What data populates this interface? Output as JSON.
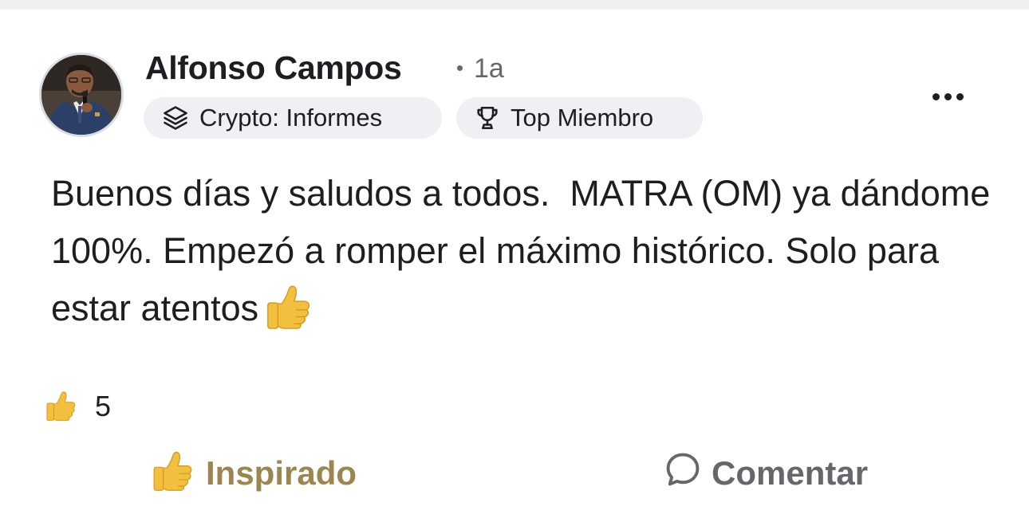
{
  "post": {
    "author": "Alfonso Campos",
    "timestamp": "1a",
    "badges": [
      {
        "label": "Crypto: Informes",
        "icon": "layers-icon"
      },
      {
        "label": "Top Miembro",
        "icon": "trophy-icon"
      }
    ],
    "body_text": "Buenos días y saludos a todos.  MATRA (OM) ya dándome 100%. Empezó a romper el máximo histórico. Solo para estar atentos",
    "body_emoji": "thumbs-up-emoji"
  },
  "reactions": {
    "icon": "thumbs-up-emoji",
    "count": "5"
  },
  "actions": {
    "like_label": "Inspirado",
    "comment_label": "Comentar"
  },
  "colors": {
    "reacted_accent": "#9c8650",
    "secondary_text": "#65676b",
    "chip_background": "#eef0f3"
  }
}
